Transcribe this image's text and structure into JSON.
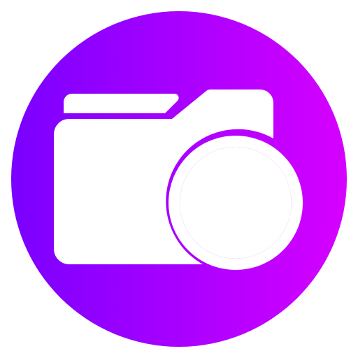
{
  "icon": {
    "name": "new-folder-icon",
    "gradient_start": "#7a00ff",
    "gradient_end": "#d600ff",
    "glyph_color": "#ffffff"
  }
}
